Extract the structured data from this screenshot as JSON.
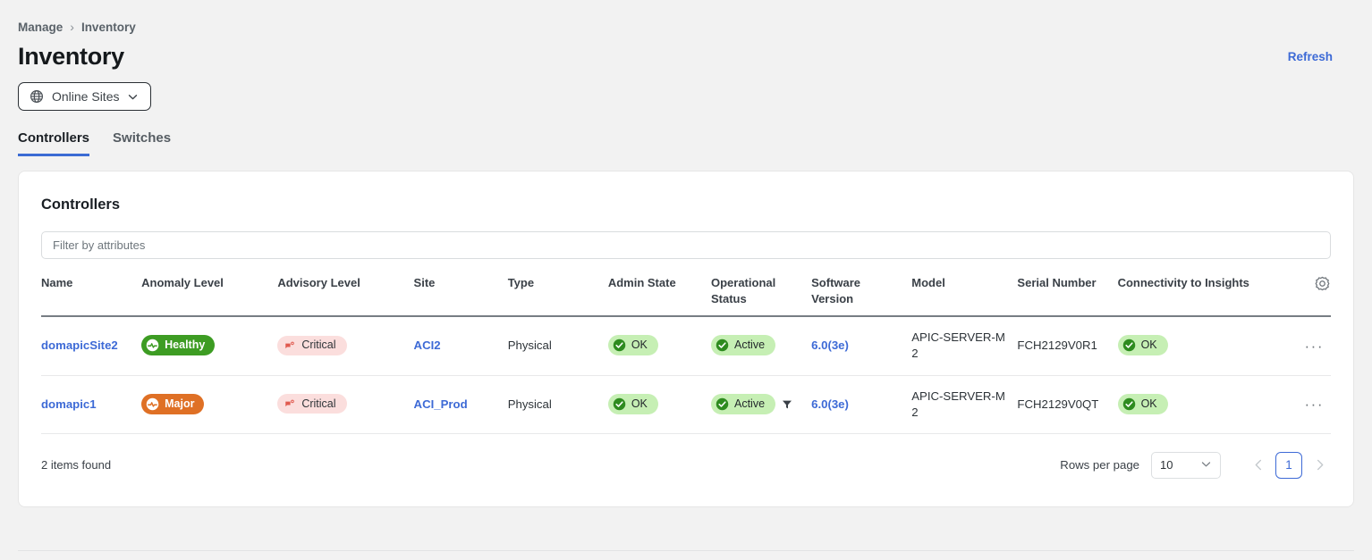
{
  "breadcrumb": {
    "parent": "Manage",
    "separator": "›",
    "current": "Inventory"
  },
  "header": {
    "title": "Inventory",
    "refresh_label": "Refresh",
    "site_selector": {
      "label": "Online Sites",
      "icon": "globe-icon",
      "chevron": "chevron-down-icon"
    }
  },
  "tabs": [
    {
      "label": "Controllers",
      "active": true
    },
    {
      "label": "Switches",
      "active": false
    }
  ],
  "card": {
    "title": "Controllers",
    "filter": {
      "value": "",
      "placeholder": "Filter by attributes"
    },
    "settings_icon": "gear-icon"
  },
  "table": {
    "columns": [
      "Name",
      "Anomaly Level",
      "Advisory Level",
      "Site",
      "Type",
      "Admin State",
      "Operational Status",
      "Software Version",
      "Model",
      "Serial Number",
      "Connectivity to Insights"
    ],
    "rows": [
      {
        "name": "domapicSite2",
        "anomaly": {
          "label": "Healthy",
          "style": "solid-green",
          "icon": "pulse-icon"
        },
        "advisory": {
          "label": "Critical",
          "style": "soft-red",
          "icon": "megaphone-icon"
        },
        "site": "ACI2",
        "type": "Physical",
        "admin_state": {
          "label": "OK",
          "style": "soft-green",
          "icon": "check-circle-icon"
        },
        "operational": {
          "label": "Active",
          "style": "soft-green",
          "icon": "check-circle-icon",
          "filtered": false
        },
        "software_version": "6.0(3e)",
        "model": "APIC-SERVER-M2",
        "serial": "FCH2129V0R1",
        "connectivity": {
          "label": "OK",
          "style": "soft-green",
          "icon": "check-circle-icon"
        },
        "row_menu": "···"
      },
      {
        "name": "domapic1",
        "anomaly": {
          "label": "Major",
          "style": "solid-orange",
          "icon": "pulse-icon"
        },
        "advisory": {
          "label": "Critical",
          "style": "soft-red",
          "icon": "megaphone-icon"
        },
        "site": "ACI_Prod",
        "type": "Physical",
        "admin_state": {
          "label": "OK",
          "style": "soft-green",
          "icon": "check-circle-icon"
        },
        "operational": {
          "label": "Active",
          "style": "soft-green",
          "icon": "check-circle-icon",
          "filtered": true
        },
        "software_version": "6.0(3e)",
        "model": "APIC-SERVER-M2",
        "serial": "FCH2129V0QT",
        "connectivity": {
          "label": "OK",
          "style": "soft-green",
          "icon": "check-circle-icon"
        },
        "row_menu": "···"
      }
    ]
  },
  "footer": {
    "items_found": "2 items found",
    "rows_per_page_label": "Rows per page",
    "rows_per_page_value": "10",
    "page_current": "1",
    "prev_enabled": false,
    "next_enabled": false
  },
  "colors": {
    "accent_blue": "#3d6ad6",
    "healthy_green": "#3d9c23",
    "major_orange": "#df7025",
    "critical_pink": "#fbdedd",
    "ok_green_bg": "#c6efb4",
    "page_bg": "#f2f2f2"
  }
}
